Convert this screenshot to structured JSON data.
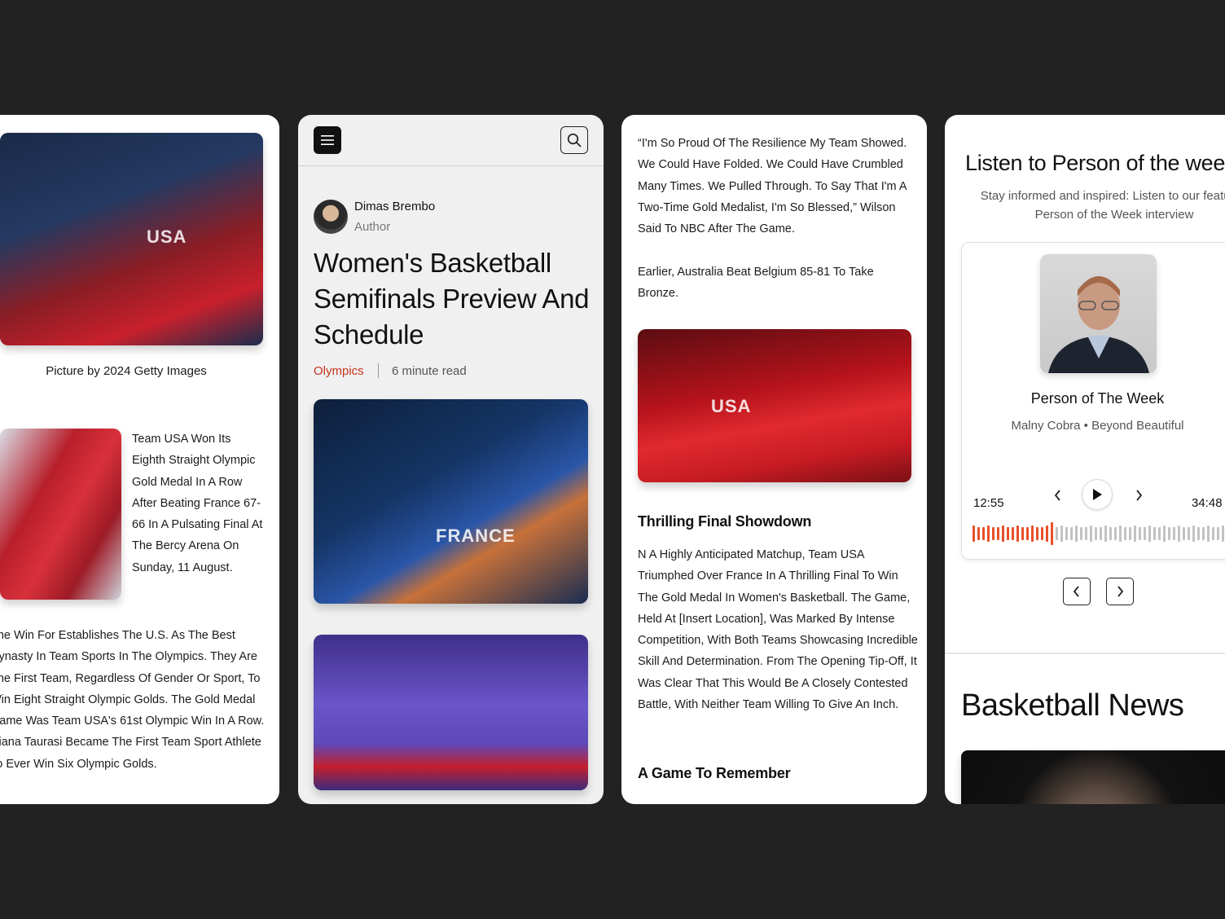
{
  "card1": {
    "caption": "Picture by 2024 Getty Images",
    "side_text": "Team USA Won Its Eighth Straight Olympic Gold Medal In A Row After Beating France 67-66 In A Pulsating Final At The Bercy Arena On Sunday, 11 August.",
    "body_text": "The Win For Establishes The U.S. As The Best Dynasty In Team Sports In The Olympics. They Are The First Team, Regardless Of Gender Or Sport, To Win Eight Straight Olympic Golds. The Gold Medal Game Was Team USA's 61st Olympic Win In A Row. Diana Taurasi Became The First Team Sport Athlete To Ever Win Six Olympic Golds.",
    "photo1_label": "USA",
    "photo2_label": ""
  },
  "card2": {
    "author_name": "Dimas Brembo",
    "author_role": "Author",
    "headline": "Women's Basketball Semifinals Preview And Schedule",
    "tag": "Olympics",
    "read_time": "6 minute read",
    "photo1_label": "FRANCE",
    "photo2_label": ""
  },
  "card3": {
    "quote": "“I'm So Proud Of The Resilience My Team Showed. We Could Have Folded. We Could Have Crumbled Many Times. We Pulled Through. To Say That I'm A Two-Time Gold Medalist, I'm So Blessed,” Wilson Said To NBC After The Game.",
    "bronze": "Earlier, Australia Beat Belgium 85-81 To Take Bronze.",
    "photo_label": "USA",
    "section1_title": "Thrilling Final Showdown",
    "section1_body": "N A Highly Anticipated Matchup, Team USA Triumphed Over France In A Thrilling Final To Win The Gold Medal In Women's Basketball. The Game, Held At [Insert Location], Was Marked By Intense Competition, With Both Teams Showcasing Incredible Skill And Determination. From The Opening Tip-Off, It Was Clear That This Would Be A Closely Contested Battle, With Neither Team Willing To Give An Inch.",
    "section2_title": "A Game To Remember"
  },
  "card4": {
    "title": "Listen to Person of the week",
    "subtitle": "Stay informed and inspired: Listen to our featured Person of the Week interview",
    "person_title": "Person of The Week",
    "person_meta": "Malny Cobra • Beyond Beautiful",
    "time_elapsed": "12:55",
    "time_total": "34:48",
    "progress_fraction": 0.3,
    "news_title": "Basketball News"
  },
  "colors": {
    "accent": "#c5341c",
    "wave_played": "#e8502a",
    "wave_unplayed": "#c2c2c2",
    "background": "#222222"
  },
  "icons": [
    "menu-icon",
    "search-icon",
    "chevron-left-icon",
    "chevron-right-icon",
    "play-icon"
  ]
}
